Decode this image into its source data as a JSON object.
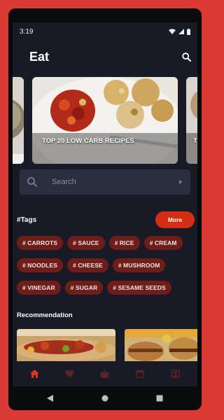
{
  "status_bar": {
    "time": "3:19"
  },
  "header": {
    "title": "Eat",
    "search_icon": "search-icon"
  },
  "carousel": {
    "main_caption": "TOP 20 LOW CARB RECIPES",
    "right_caption": "T"
  },
  "search": {
    "placeholder": "Search"
  },
  "tags": {
    "title": "#Tags",
    "more_label": "More",
    "items": [
      "# CARROTS",
      "# SAUCE",
      "# RICE",
      "# CREAM",
      "# NOODLES",
      "# CHEESE",
      "# MUSHROOM",
      "# VINEGAR",
      "# SUGAR",
      "# SESAME SEEDS"
    ]
  },
  "recommendation": {
    "title": "Recommendation"
  },
  "bottom_nav": {
    "items": [
      {
        "icon": "home-icon",
        "active": true
      },
      {
        "icon": "heart-icon",
        "active": false
      },
      {
        "icon": "basket-icon",
        "active": false
      },
      {
        "icon": "calendar-icon",
        "active": false
      },
      {
        "icon": "profile-icon",
        "active": false
      }
    ]
  },
  "colors": {
    "accent": "#d42f14",
    "active_nav": "#e0321c",
    "inactive_nav": "#5a2324",
    "tag_bg": "#6e1d1a",
    "background": "#181a26",
    "frame": "#d93a35"
  }
}
